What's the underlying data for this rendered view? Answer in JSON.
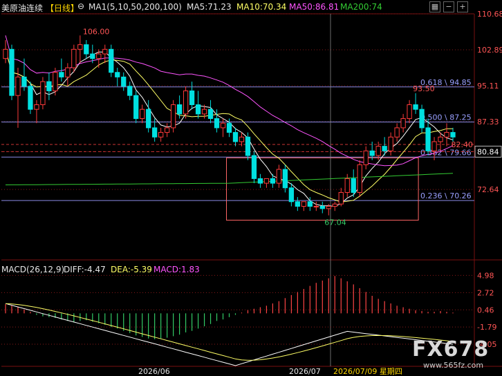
{
  "header": {
    "instrument": "美原油连续",
    "period": "【日线】",
    "ma_params": "MA1(5,10,50,200,100)",
    "ma5": "MA5:71.23",
    "ma10": "MA10:70.34",
    "ma50": "MA50:86.81",
    "ma200": "MA200:74"
  },
  "macd": {
    "params": "MACD(26,12,9)",
    "diff": "DIFF:-4.47",
    "dea": "DEA:-5.39",
    "macd": "MACD:1.83"
  },
  "watermark": {
    "brand": "FX678",
    "site": "www.565fz.com"
  },
  "colors": {
    "up": "#ff3b3b",
    "down": "#00e0e0",
    "ma5": "#ffffff",
    "ma10": "#ffff66",
    "ma50": "#ff55ff",
    "ma200": "#33cc33",
    "grid": "#8a1a1a",
    "fib": "#8a8ae6",
    "box": "#ff6666"
  },
  "chart_data": {
    "type": "candlestick",
    "price_axis_ticks": [
      "110.68",
      "102.89",
      "95.11",
      "87.33",
      "80.84",
      "72.64"
    ],
    "price_range": [
      58.0,
      110.68
    ],
    "current_price": "80.84",
    "time_labels": [
      "2026/06",
      "2026/07",
      "2026/07/09 星期四"
    ],
    "annotations": [
      "106.00",
      "67.04",
      "93.50",
      "82.40"
    ],
    "fib_levels": [
      {
        "label": "0.618 \\ 94.85",
        "value": 94.85
      },
      {
        "label": "0.500 \\ 87.25",
        "value": 87.25
      },
      {
        "label": "0.382 \\ 79.66",
        "value": 79.66
      },
      {
        "label": "0.236 \\ 70.26",
        "value": 70.26
      }
    ],
    "dashed_levels": [
      82.4,
      80.84
    ],
    "candles": [
      [
        101,
        105,
        100,
        103
      ],
      [
        103,
        104,
        92,
        93
      ],
      [
        93,
        99,
        86,
        97
      ],
      [
        97,
        101,
        94,
        95
      ],
      [
        95,
        96,
        89,
        90
      ],
      [
        90,
        92,
        87,
        91
      ],
      [
        91,
        97,
        90,
        96
      ],
      [
        96,
        98,
        92,
        94
      ],
      [
        94,
        99,
        93,
        98
      ],
      [
        98,
        101,
        96,
        97
      ],
      [
        97,
        100,
        95,
        99
      ],
      [
        99,
        104,
        98,
        103
      ],
      [
        103,
        106,
        100,
        104
      ],
      [
        104,
        105,
        101,
        102
      ],
      [
        102,
        104,
        100,
        101
      ],
      [
        101,
        103,
        99,
        102
      ],
      [
        102,
        104,
        100,
        103
      ],
      [
        103,
        104,
        97,
        98
      ],
      [
        98,
        99,
        95,
        97
      ],
      [
        97,
        98,
        94,
        95
      ],
      [
        95,
        96,
        92,
        93
      ],
      [
        93,
        94,
        87,
        88
      ],
      [
        88,
        91,
        87,
        90
      ],
      [
        90,
        92,
        85,
        86
      ],
      [
        86,
        88,
        83,
        84
      ],
      [
        84,
        86,
        83,
        85
      ],
      [
        85,
        87,
        84,
        86
      ],
      [
        86,
        92,
        85,
        91
      ],
      [
        91,
        93,
        88,
        89
      ],
      [
        89,
        95,
        88,
        94
      ],
      [
        94,
        96,
        90,
        91
      ],
      [
        91,
        94,
        88,
        89
      ],
      [
        89,
        91,
        88,
        90
      ],
      [
        90,
        92,
        87,
        88
      ],
      [
        88,
        90,
        85,
        86
      ],
      [
        86,
        88,
        84,
        87
      ],
      [
        87,
        88,
        84,
        85
      ],
      [
        85,
        86,
        82,
        83
      ],
      [
        83,
        85,
        82,
        84
      ],
      [
        84,
        85,
        79,
        80
      ],
      [
        80,
        81,
        74,
        75
      ],
      [
        75,
        76,
        73,
        74
      ],
      [
        74,
        75,
        73,
        75
      ],
      [
        75,
        76,
        73,
        74
      ],
      [
        74,
        78,
        73,
        77
      ],
      [
        77,
        78,
        72,
        73
      ],
      [
        73,
        74,
        69,
        70
      ],
      [
        70,
        71,
        68,
        69
      ],
      [
        69,
        70,
        68,
        70
      ],
      [
        70,
        71,
        68,
        69
      ],
      [
        69,
        70,
        68,
        69
      ],
      [
        69,
        70,
        67.5,
        68.5
      ],
      [
        68.5,
        69.5,
        67.04,
        69
      ],
      [
        69,
        70,
        68,
        69.5
      ],
      [
        69.5,
        73,
        69,
        72
      ],
      [
        72,
        76,
        71,
        75
      ],
      [
        75,
        77,
        71,
        72
      ],
      [
        72,
        79,
        71,
        78
      ],
      [
        78,
        82,
        77,
        81
      ],
      [
        81,
        83,
        79,
        80
      ],
      [
        80,
        83,
        79,
        82
      ],
      [
        82,
        84,
        80,
        81
      ],
      [
        81,
        85,
        80,
        84
      ],
      [
        84,
        87,
        83,
        86
      ],
      [
        86,
        89,
        85,
        88
      ],
      [
        88,
        92,
        87,
        91
      ],
      [
        91,
        93.5,
        89,
        90
      ],
      [
        90,
        91,
        85,
        86
      ],
      [
        86,
        88,
        80,
        81
      ],
      [
        81,
        84,
        79,
        83
      ],
      [
        83,
        85,
        81,
        84
      ],
      [
        84,
        87,
        82,
        85
      ],
      [
        85,
        86,
        83,
        84
      ]
    ],
    "macd_axis_ticks": [
      "4.98",
      "2.72",
      "0.46",
      "-1.79",
      "-4.05"
    ],
    "macd_range": [
      -6.5,
      5.2
    ],
    "macd_hist": [
      1.2,
      1.0,
      0.8,
      0.5,
      0.2,
      -0.2,
      -0.4,
      -0.5,
      -0.6,
      -0.8,
      -1.0,
      -1.2,
      -1.0,
      -0.9,
      -1.1,
      -1.3,
      -1.5,
      -1.8,
      -2.0,
      -2.3,
      -2.6,
      -2.9,
      -3.1,
      -3.3,
      -3.4,
      -3.3,
      -3.2,
      -3.0,
      -2.8,
      -2.5,
      -2.3,
      -2.0,
      -1.7,
      -1.4,
      -1.0,
      -0.8,
      -0.5,
      -0.2,
      0.1,
      0.4,
      0.6,
      0.8,
      1.0,
      1.3,
      1.6,
      2.0,
      2.4,
      2.8,
      3.2,
      3.6,
      4.0,
      4.3,
      4.6,
      4.9,
      4.6,
      4.2,
      3.8,
      3.3,
      2.8,
      2.3,
      1.9,
      1.6,
      1.3,
      1.0,
      0.8,
      0.6,
      0.4,
      0.3,
      0.2,
      0.2,
      0.3,
      0.2,
      0.1
    ]
  }
}
